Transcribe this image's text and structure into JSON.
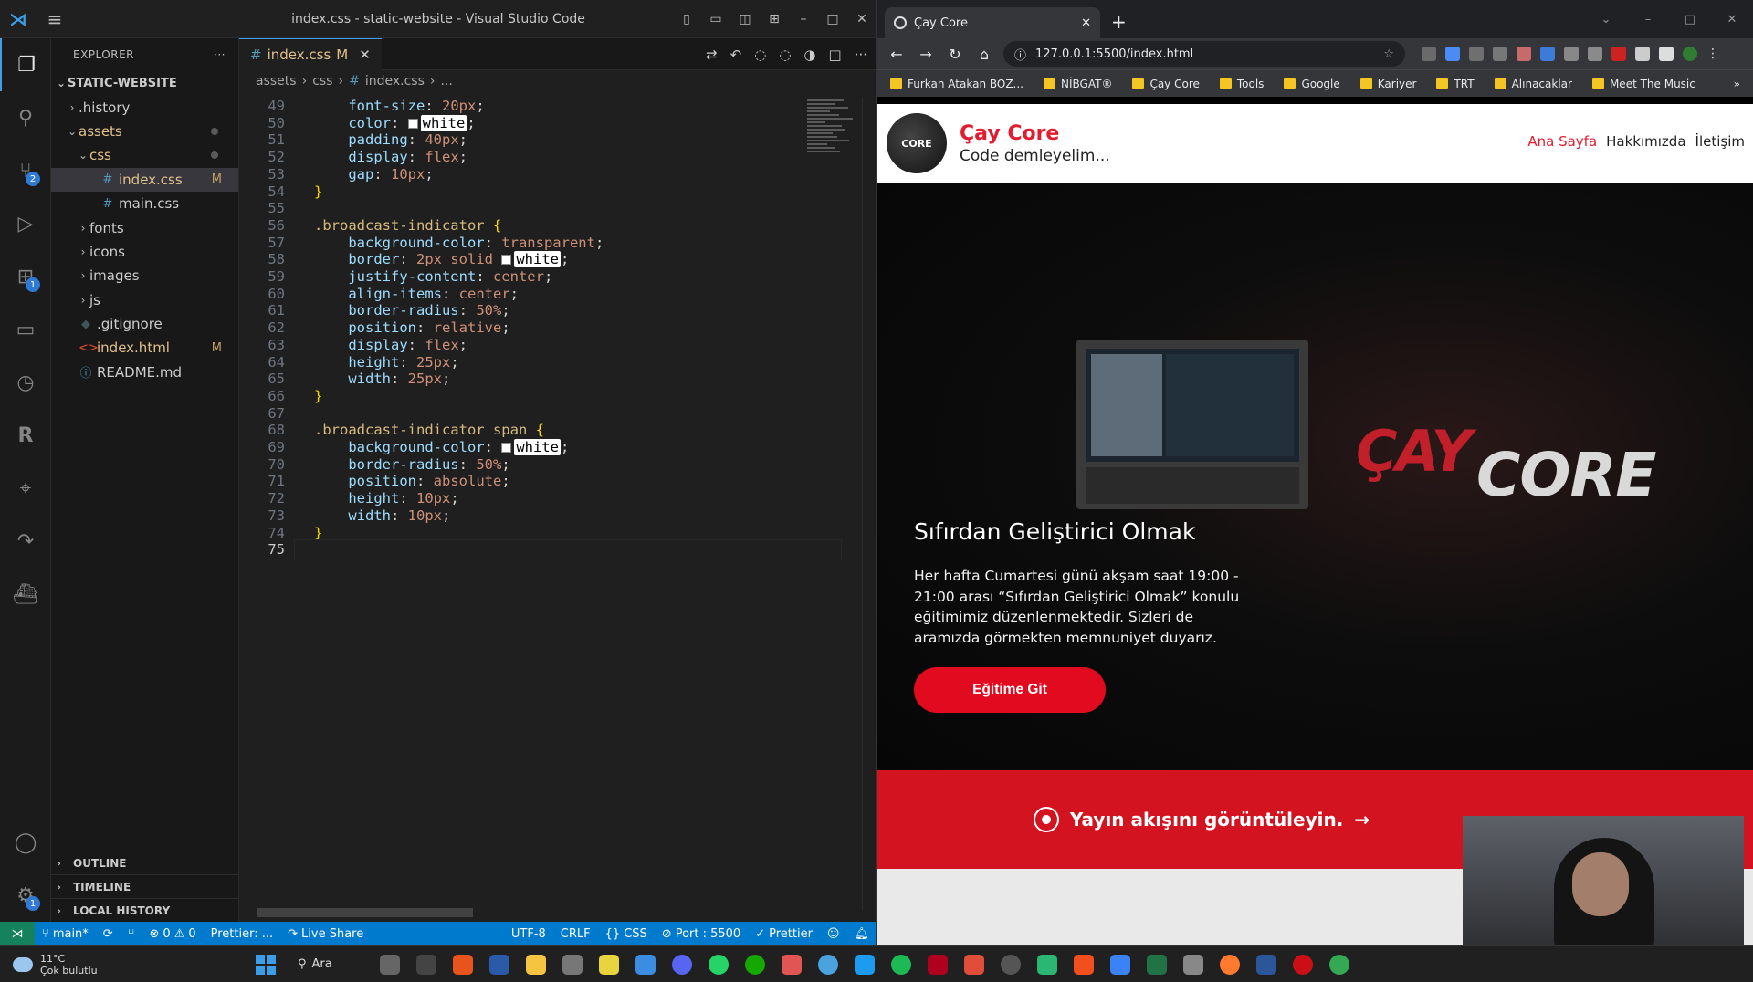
{
  "vscode": {
    "window_title": "index.css - static-website - Visual Studio Code",
    "explorer_title": "EXPLORER",
    "project": "STATIC-WEBSITE",
    "tree": [
      {
        "label": ".history",
        "indent": 1,
        "type": "folder",
        "open": false
      },
      {
        "label": "assets",
        "indent": 1,
        "type": "folder",
        "open": true,
        "dot": true,
        "mod": true
      },
      {
        "label": "css",
        "indent": 2,
        "type": "folder",
        "open": true,
        "dot": true,
        "mod": true
      },
      {
        "label": "index.css",
        "indent": 3,
        "type": "css",
        "badge": "M",
        "selected": true,
        "mod": true
      },
      {
        "label": "main.css",
        "indent": 3,
        "type": "css"
      },
      {
        "label": "fonts",
        "indent": 2,
        "type": "folder",
        "open": false
      },
      {
        "label": "icons",
        "indent": 2,
        "type": "folder",
        "open": false
      },
      {
        "label": "images",
        "indent": 2,
        "type": "folder",
        "open": false
      },
      {
        "label": "js",
        "indent": 2,
        "type": "folder",
        "open": false
      },
      {
        "label": ".gitignore",
        "indent": 1,
        "type": "git"
      },
      {
        "label": "index.html",
        "indent": 1,
        "type": "html",
        "badge": "M",
        "mod": true
      },
      {
        "label": "README.md",
        "indent": 1,
        "type": "md"
      }
    ],
    "sections": [
      "OUTLINE",
      "TIMELINE",
      "LOCAL HISTORY"
    ],
    "tab": {
      "label": "index.css",
      "badge": "M"
    },
    "breadcrumb": [
      "assets",
      "css",
      "index.css",
      "..."
    ],
    "current_line": 75,
    "code_lines": [
      {
        "n": 49,
        "tokens": [
          [
            "    ",
            "punc"
          ],
          [
            "font-size",
            "prop"
          ],
          [
            ": ",
            "punc"
          ],
          [
            "20px",
            "val"
          ],
          [
            ";",
            "punc"
          ]
        ]
      },
      {
        "n": 50,
        "tokens": [
          [
            "    ",
            "punc"
          ],
          [
            "color",
            "prop"
          ],
          [
            ": ",
            "punc"
          ],
          [
            "@white",
            "val"
          ],
          [
            ";",
            "punc"
          ]
        ]
      },
      {
        "n": 51,
        "tokens": [
          [
            "    ",
            "punc"
          ],
          [
            "padding",
            "prop"
          ],
          [
            ": ",
            "punc"
          ],
          [
            "40px",
            "val"
          ],
          [
            ";",
            "punc"
          ]
        ]
      },
      {
        "n": 52,
        "tokens": [
          [
            "    ",
            "punc"
          ],
          [
            "display",
            "prop"
          ],
          [
            ": ",
            "punc"
          ],
          [
            "flex",
            "val"
          ],
          [
            ";",
            "punc"
          ]
        ]
      },
      {
        "n": 53,
        "tokens": [
          [
            "    ",
            "punc"
          ],
          [
            "gap",
            "prop"
          ],
          [
            ": ",
            "punc"
          ],
          [
            "10px",
            "val"
          ],
          [
            ";",
            "punc"
          ]
        ]
      },
      {
        "n": 54,
        "tokens": [
          [
            "}",
            "brace"
          ]
        ]
      },
      {
        "n": 55,
        "tokens": []
      },
      {
        "n": 56,
        "tokens": [
          [
            ".broadcast-indicator",
            "sel-t"
          ],
          [
            " ",
            "punc"
          ],
          [
            "{",
            "brace"
          ]
        ]
      },
      {
        "n": 57,
        "tokens": [
          [
            "    ",
            "punc"
          ],
          [
            "background-color",
            "prop"
          ],
          [
            ": ",
            "punc"
          ],
          [
            "transparent",
            "val"
          ],
          [
            ";",
            "punc"
          ]
        ]
      },
      {
        "n": 58,
        "tokens": [
          [
            "    ",
            "punc"
          ],
          [
            "border",
            "prop"
          ],
          [
            ": ",
            "punc"
          ],
          [
            "2px solid ",
            "val"
          ],
          [
            "@white",
            "val"
          ],
          [
            ";",
            "punc"
          ]
        ]
      },
      {
        "n": 59,
        "tokens": [
          [
            "    ",
            "punc"
          ],
          [
            "justify-content",
            "prop"
          ],
          [
            ": ",
            "punc"
          ],
          [
            "center",
            "val"
          ],
          [
            ";",
            "punc"
          ]
        ]
      },
      {
        "n": 60,
        "tokens": [
          [
            "    ",
            "punc"
          ],
          [
            "align-items",
            "prop"
          ],
          [
            ": ",
            "punc"
          ],
          [
            "center",
            "val"
          ],
          [
            ";",
            "punc"
          ]
        ]
      },
      {
        "n": 61,
        "tokens": [
          [
            "    ",
            "punc"
          ],
          [
            "border-radius",
            "prop"
          ],
          [
            ": ",
            "punc"
          ],
          [
            "50%",
            "val"
          ],
          [
            ";",
            "punc"
          ]
        ]
      },
      {
        "n": 62,
        "tokens": [
          [
            "    ",
            "punc"
          ],
          [
            "position",
            "prop"
          ],
          [
            ": ",
            "punc"
          ],
          [
            "relative",
            "val"
          ],
          [
            ";",
            "punc"
          ]
        ]
      },
      {
        "n": 63,
        "tokens": [
          [
            "    ",
            "punc"
          ],
          [
            "display",
            "prop"
          ],
          [
            ": ",
            "punc"
          ],
          [
            "flex",
            "val"
          ],
          [
            ";",
            "punc"
          ]
        ]
      },
      {
        "n": 64,
        "tokens": [
          [
            "    ",
            "punc"
          ],
          [
            "height",
            "prop"
          ],
          [
            ": ",
            "punc"
          ],
          [
            "25px",
            "val"
          ],
          [
            ";",
            "punc"
          ]
        ]
      },
      {
        "n": 65,
        "tokens": [
          [
            "    ",
            "punc"
          ],
          [
            "width",
            "prop"
          ],
          [
            ": ",
            "punc"
          ],
          [
            "25px",
            "val"
          ],
          [
            ";",
            "punc"
          ]
        ]
      },
      {
        "n": 66,
        "tokens": [
          [
            "}",
            "brace"
          ]
        ]
      },
      {
        "n": 67,
        "tokens": []
      },
      {
        "n": 68,
        "tokens": [
          [
            ".broadcast-indicator span",
            "sel-t"
          ],
          [
            " ",
            "punc"
          ],
          [
            "{",
            "brace"
          ]
        ]
      },
      {
        "n": 69,
        "tokens": [
          [
            "    ",
            "punc"
          ],
          [
            "background-color",
            "prop"
          ],
          [
            ": ",
            "punc"
          ],
          [
            "@white",
            "val"
          ],
          [
            ";",
            "punc"
          ]
        ]
      },
      {
        "n": 70,
        "tokens": [
          [
            "    ",
            "punc"
          ],
          [
            "border-radius",
            "prop"
          ],
          [
            ": ",
            "punc"
          ],
          [
            "50%",
            "val"
          ],
          [
            ";",
            "punc"
          ]
        ]
      },
      {
        "n": 71,
        "tokens": [
          [
            "    ",
            "punc"
          ],
          [
            "position",
            "prop"
          ],
          [
            ": ",
            "punc"
          ],
          [
            "absolute",
            "val"
          ],
          [
            ";",
            "punc"
          ]
        ]
      },
      {
        "n": 72,
        "tokens": [
          [
            "    ",
            "punc"
          ],
          [
            "height",
            "prop"
          ],
          [
            ": ",
            "punc"
          ],
          [
            "10px",
            "val"
          ],
          [
            ";",
            "punc"
          ]
        ]
      },
      {
        "n": 73,
        "tokens": [
          [
            "    ",
            "punc"
          ],
          [
            "width",
            "prop"
          ],
          [
            ": ",
            "punc"
          ],
          [
            "10px",
            "val"
          ],
          [
            ";",
            "punc"
          ]
        ]
      },
      {
        "n": 74,
        "tokens": [
          [
            "}",
            "brace"
          ]
        ]
      },
      {
        "n": 75,
        "tokens": []
      }
    ],
    "status": {
      "branch": "main*",
      "errors": "0",
      "warnings": "0",
      "prettier_short": "Prettier: ...",
      "live_share": "Live Share",
      "encoding": "UTF-8",
      "eol": "CRLF",
      "language": "CSS",
      "port": "Port : 5500",
      "prettier": "Prettier"
    }
  },
  "browser": {
    "tab_title": "Çay Core",
    "url": "127.0.0.1:5500/index.html",
    "bookmarks": [
      "Furkan Atakan BOZ...",
      "NİBGAT®",
      "Çay Core",
      "Tools",
      "Google",
      "Kariyer",
      "TRT",
      "Alınacaklar",
      "Meet The Music"
    ],
    "bookmark_more": "»"
  },
  "site": {
    "logo_text": "CORE",
    "title": "Çay Core",
    "subtitle": "Code demleyelim...",
    "nav": [
      "Ana Sayfa",
      "Hakkımızda",
      "İletişim"
    ],
    "hero_watermark_1": "ÇAY",
    "hero_watermark_2": "CORE",
    "hero_heading": "Sıfırdan Geliştirici Olmak",
    "hero_text": "Her hafta Cumartesi günü akşam saat 19:00 - 21:00 arası “Sıfırdan Geliştirici Olmak” konulu eğitimimiz düzenlenmektedir. Sizleri de aramızda görmekten memnuniyet duyarız.",
    "hero_button": "Eğitime Git",
    "band_text": "Yayın akışını görüntüleyin.",
    "band_arrow": "→"
  },
  "taskbar": {
    "temp": "11°C",
    "weather": "Çok bulutlu",
    "search": "Ara"
  },
  "colors": {
    "brand_red": "#e21b2f",
    "vscode_status": "#007acc"
  }
}
